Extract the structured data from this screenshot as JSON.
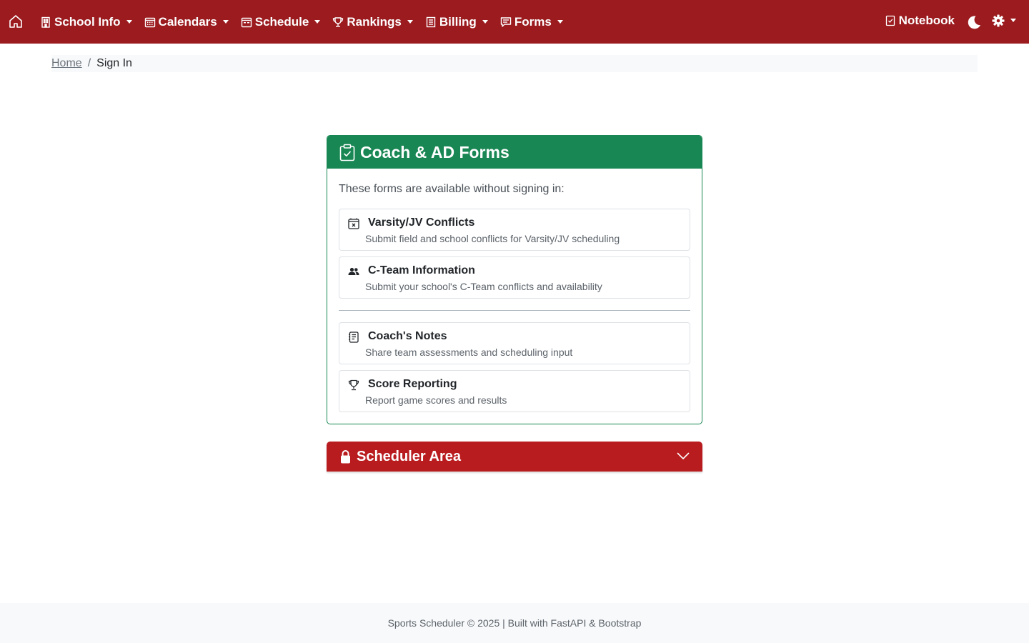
{
  "navbar": {
    "items": [
      {
        "label": "School Info",
        "icon": "building-icon"
      },
      {
        "label": "Calendars",
        "icon": "calendar-icon"
      },
      {
        "label": "Schedule",
        "icon": "calendar-week-icon"
      },
      {
        "label": "Rankings",
        "icon": "trophy-icon"
      },
      {
        "label": "Billing",
        "icon": "receipt-icon"
      },
      {
        "label": "Forms",
        "icon": "chat-square-icon"
      }
    ],
    "notebook_label": "Notebook",
    "home_icon": "house-icon",
    "theme_icon": "moon-icon",
    "settings_icon": "gear-icon",
    "color": "#9b1b1f"
  },
  "breadcrumb": {
    "home": "Home",
    "separator": "/",
    "current": "Sign In"
  },
  "forms_card": {
    "title": "Coach & AD Forms",
    "title_icon": "clipboard-check-icon",
    "intro": "These forms are available without signing in:",
    "color": "#198754",
    "items": [
      {
        "title": "Varsity/JV Conflicts",
        "description": "Submit field and school conflicts for Varsity/JV scheduling",
        "icon": "calendar-x-icon"
      },
      {
        "title": "C-Team Information",
        "description": "Submit your school's C-Team conflicts and availability",
        "icon": "people-icon"
      },
      {
        "title": "Coach's Notes",
        "description": "Share team assessments and scheduling input",
        "icon": "journal-text-icon"
      },
      {
        "title": "Score Reporting",
        "description": "Report game scores and results",
        "icon": "trophy-icon"
      }
    ]
  },
  "scheduler": {
    "title": "Scheduler Area",
    "icon": "lock-icon",
    "toggle_icon": "chevron-down-icon",
    "color": "#b91c1f"
  },
  "footer": {
    "text": "Sports Scheduler © 2025 | Built with FastAPI & Bootstrap"
  }
}
